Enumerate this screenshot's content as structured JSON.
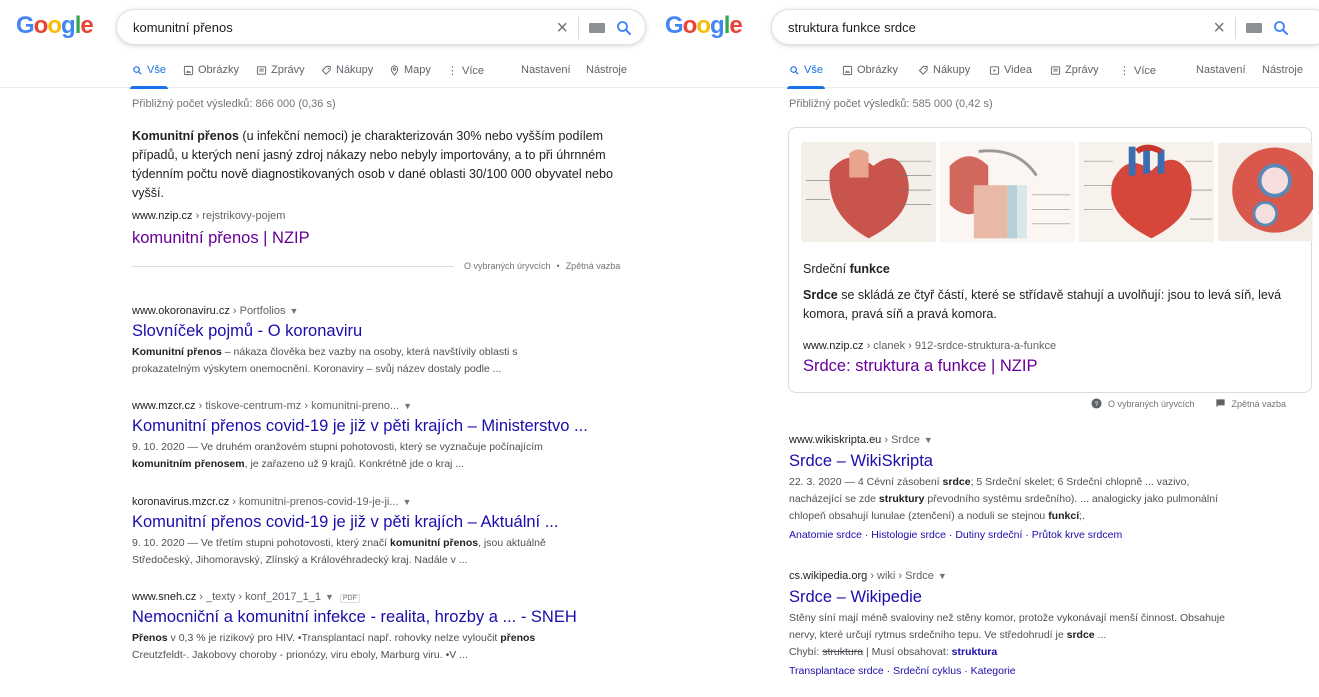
{
  "left": {
    "logo": [
      "G",
      "o",
      "o",
      "g",
      "l",
      "e"
    ],
    "query": "komunitní přenos",
    "tabs": [
      "Vše",
      "Obrázky",
      "Zprávy",
      "Nákupy",
      "Mapy",
      "Více",
      "Nastavení",
      "Nástroje"
    ],
    "stats": "Přibližný počet výsledků: 866 000 (0,36 s)",
    "featured": {
      "bold": "Komunitní přenos",
      "text_lines": [
        " (u infekční nemoci) je charakterizován 30% nebo vyšším podílem",
        "případů, u kterých není jasný zdroj nákazy nebo nebyly importovány, a to při úhrnném",
        "týdenním počtu nově diagnostikovaných osob v dané oblasti 30/100 000 obyvatel nebo",
        "vyšší."
      ],
      "url_domain": "www.nzip.cz",
      "url_crumb": " › rejstrikovy-pojem",
      "title": "komunitní přenos | NZIP",
      "feedback": [
        "O vybraných úryvcích",
        "•",
        "Zpětná vazba"
      ]
    },
    "results": [
      {
        "domain": "www.okoronaviru.cz",
        "crumb": " › Portfolios",
        "title": "Slovníček pojmů - O koronaviru",
        "lines": [
          [
            "Komunitní přenos",
            " – nákaza člověka bez vazby na osoby, která navštívily oblasti s"
          ],
          [
            "",
            "prokazatelným výskytem onemocnění. Koronaviry – svůj název dostaly podle ..."
          ]
        ]
      },
      {
        "domain": "www.mzcr.cz",
        "crumb": " › tiskove-centrum-mz › komunitni-preno...",
        "title": "Komunitní přenos covid-19 je již v pěti krajích – Ministerstvo ...",
        "lines": [
          [
            "",
            "9. 10. 2020 — Ve druhém oranžovém stupni pohotovosti, který se vyznačuje počínajícím"
          ],
          [
            "komunitním přenosem",
            ", je zařazeno už 9 krajů. Konkrétně jde o kraj ..."
          ]
        ]
      },
      {
        "domain": "koronavirus.mzcr.cz",
        "crumb": " › komunitni-prenos-covid-19-je-ji...",
        "title": "Komunitní přenos covid-19 je již v pěti krajích – Aktuální ...",
        "lines": [
          [
            "",
            "9. 10. 2020 — Ve třetím stupni pohotovosti, který značí "
          ],
          [
            "",
            "Středočeský, Jihomoravský, Zlínský a Královéhradecký kraj. Nadále v ..."
          ]
        ],
        "line1_bold": "komunitní přenos",
        "line1_tail": ", jsou aktuálně"
      },
      {
        "domain": "www.sneh.cz",
        "crumb": " › _texty › konf_2017_1_1",
        "pdf": "PDF",
        "title": "Nemocniční a komunitní infekce - realita, hrozby a ... - SNEH",
        "lines": [
          [
            "Přenos",
            " v 0,3 % je rizikový pro HIV. •Transplantací např. rohovky nelze vyloučit "
          ],
          [
            "",
            "Creutzfeldt-. Jakobovy choroby - prionózy, viru eboly, Marburg viru. •V ..."
          ]
        ],
        "line0_bold_tail": "přenos"
      }
    ]
  },
  "right": {
    "logo": [
      "G",
      "o",
      "o",
      "g",
      "l",
      "e"
    ],
    "query": "struktura funkce srdce",
    "tabs": [
      "Vše",
      "Obrázky",
      "Nákupy",
      "Videa",
      "Zprávy",
      "Více",
      "Nastavení",
      "Nástroje"
    ],
    "stats": "Přibližný počet výsledků: 585 000 (0,42 s)",
    "featured": {
      "heading_plain": "Srdeční ",
      "heading_bold": "funkce",
      "bold": "Srdce",
      "text_lines": [
        " se skládá ze čtyř částí, které se střídavě stahují a uvolňují: jsou to levá síň, levá",
        "komora, pravá síň a pravá komora."
      ],
      "url_domain": "www.nzip.cz",
      "url_crumb": " › clanek › 912-srdce-struktura-a-funkce",
      "title": "Srdce: struktura a funkce | NZIP",
      "feedback": [
        "O vybraných úryvcích",
        "Zpětná vazba"
      ]
    },
    "results": [
      {
        "domain": "www.wikiskripta.eu",
        "crumb": " › Srdce",
        "title": "Srdce – WikiSkripta",
        "line1_a": "22. 3. 2020 — 4 Cévní zásobení ",
        "line1_b": "srdce",
        "line1_c": "; 5 Srdeční skelet; 6 Srdeční chlopně ... vazivo,",
        "line2_a": "nacházející se zde ",
        "line2_b": "struktury",
        "line2_c": " převodního systému srdečního). ... analogicky jako pulmonální",
        "line3_a": "chlopeň obsahují lunulae (ztenčení) a noduli se stejnou ",
        "line3_b": "funkcí",
        "line3_c": ";.",
        "sitelinks": "Anatomie srdce · Histologie srdce · Dutiny srdeční · Průtok krve srdcem"
      },
      {
        "domain": "cs.wikipedia.org",
        "crumb": " › wiki › Srdce",
        "title": "Srdce – Wikipedie",
        "line1": "Stěny síní mají méně svaloviny než stěny komor, protože vykonávají menší činnost. Obsahuje",
        "line2_a": "nervy, které určují rytmus srdečního tepu. Ve středohrudí je ",
        "line2_b": "srdce",
        "line2_c": " ...",
        "missing_a": "Chybí: ",
        "missing_strike": "struktura",
        "missing_b": " | Musí obsahovat: ",
        "missing_link": "struktura",
        "sitelinks": "Transplantace srdce · Srdeční cyklus · Kategorie"
      }
    ]
  },
  "colors": {
    "link": "#1a0dab",
    "visited": "#660099",
    "accent": "#1a73e8",
    "text": "#202124",
    "muted": "#70757a"
  }
}
